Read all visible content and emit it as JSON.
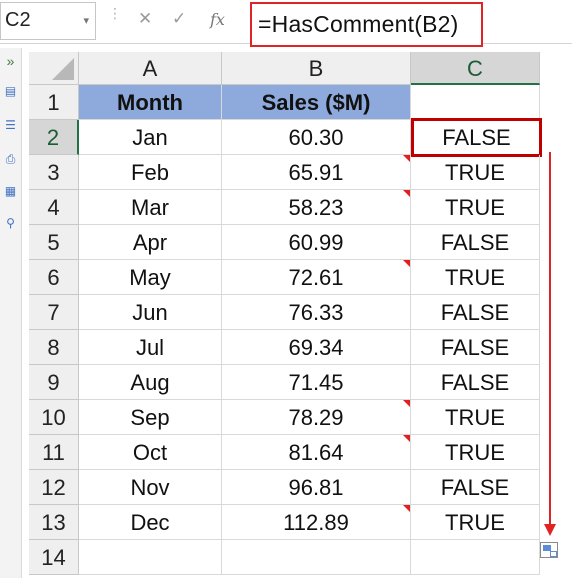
{
  "formula_bar": {
    "name_box": "C2",
    "cancel_glyph": "✕",
    "enter_glyph": "✓",
    "fx_label": "fx",
    "formula": "=HasComment(B2)"
  },
  "columns": [
    "A",
    "B",
    "C"
  ],
  "rows": [
    {
      "num": "1",
      "month": "Month",
      "sales": "Sales ($M)",
      "result": "",
      "is_header": true,
      "comment": false
    },
    {
      "num": "2",
      "month": "Jan",
      "sales": "60.30",
      "result": "FALSE",
      "comment": false
    },
    {
      "num": "3",
      "month": "Feb",
      "sales": "65.91",
      "result": "TRUE",
      "comment": true
    },
    {
      "num": "4",
      "month": "Mar",
      "sales": "58.23",
      "result": "TRUE",
      "comment": true
    },
    {
      "num": "5",
      "month": "Apr",
      "sales": "60.99",
      "result": "FALSE",
      "comment": false
    },
    {
      "num": "6",
      "month": "May",
      "sales": "72.61",
      "result": "TRUE",
      "comment": true
    },
    {
      "num": "7",
      "month": "Jun",
      "sales": "76.33",
      "result": "FALSE",
      "comment": false
    },
    {
      "num": "8",
      "month": "Jul",
      "sales": "69.34",
      "result": "FALSE",
      "comment": false
    },
    {
      "num": "9",
      "month": "Aug",
      "sales": "71.45",
      "result": "FALSE",
      "comment": false
    },
    {
      "num": "10",
      "month": "Sep",
      "sales": "78.29",
      "result": "TRUE",
      "comment": true
    },
    {
      "num": "11",
      "month": "Oct",
      "sales": "81.64",
      "result": "TRUE",
      "comment": true
    },
    {
      "num": "12",
      "month": "Nov",
      "sales": "96.81",
      "result": "FALSE",
      "comment": false
    },
    {
      "num": "13",
      "month": "Dec",
      "sales": "112.89",
      "result": "TRUE",
      "comment": true
    },
    {
      "num": "14",
      "month": "",
      "sales": "",
      "result": "",
      "comment": false
    }
  ],
  "selected_cell": "C2",
  "colors": {
    "header_fill": "#8ea9db",
    "selection_border": "#c00000",
    "annotation_red": "#e02424",
    "comment_indicator": "#e02020"
  },
  "icons": {
    "name_box_dropdown": "chevron-down-icon",
    "cancel": "cancel-icon",
    "enter": "checkmark-icon",
    "function": "insert-function-icon",
    "fill_arrow": "arrow-down-icon",
    "autofill_options": "autofill-options-icon"
  }
}
